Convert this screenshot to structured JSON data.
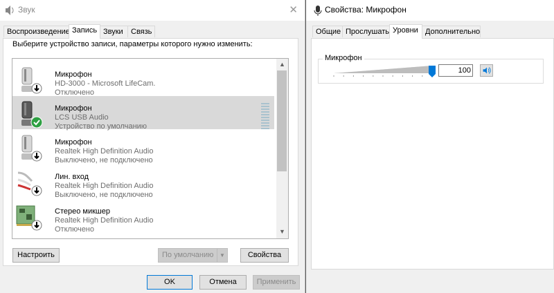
{
  "sound": {
    "title": "Звук",
    "close": "✕",
    "tabs": [
      "Воспроизведение",
      "Запись",
      "Звуки",
      "Связь"
    ],
    "active_tab": "Запись",
    "instruction": "Выберите устройство записи, параметры которого нужно изменить:",
    "devices": [
      {
        "name": "Микрофон",
        "desc": "HD-3000 - Microsoft LifeCam.",
        "status": "Отключено",
        "icon": "microphone-icon",
        "badge": "down-arrow"
      },
      {
        "name": "Микрофон",
        "desc": "LCS USB Audio",
        "status": "Устройство по умолчанию",
        "icon": "microphone-icon",
        "badge": "green-check",
        "selected": true
      },
      {
        "name": "Микрофон",
        "desc": "Realtek High Definition Audio",
        "status": "Выключено, не подключено",
        "icon": "microphone-icon",
        "badge": "down-arrow"
      },
      {
        "name": "Лин. вход",
        "desc": "Realtek High Definition Audio",
        "status": "Выключено, не подключено",
        "icon": "line-in-cable-icon",
        "badge": "down-arrow"
      },
      {
        "name": "Стерео микшер",
        "desc": "Realtek High Definition Audio",
        "status": "Отключено",
        "icon": "sound-card-icon",
        "badge": "down-arrow"
      }
    ],
    "buttons": {
      "configure": "Настроить",
      "default": "По умолчанию",
      "properties": "Свойства"
    },
    "footer": {
      "ok": "OK",
      "cancel": "Отмена",
      "apply": "Применить"
    }
  },
  "props": {
    "title": "Свойства: Микрофон",
    "tabs": [
      "Общие",
      "Прослушать",
      "Уровни",
      "Дополнительно"
    ],
    "active_tab": "Уровни",
    "group_label": "Микрофон",
    "level": 100,
    "level_max": 100
  },
  "colors": {
    "accent": "#0078d7",
    "selected_row": "#d9d9d9",
    "check_green": "#2ea043"
  }
}
